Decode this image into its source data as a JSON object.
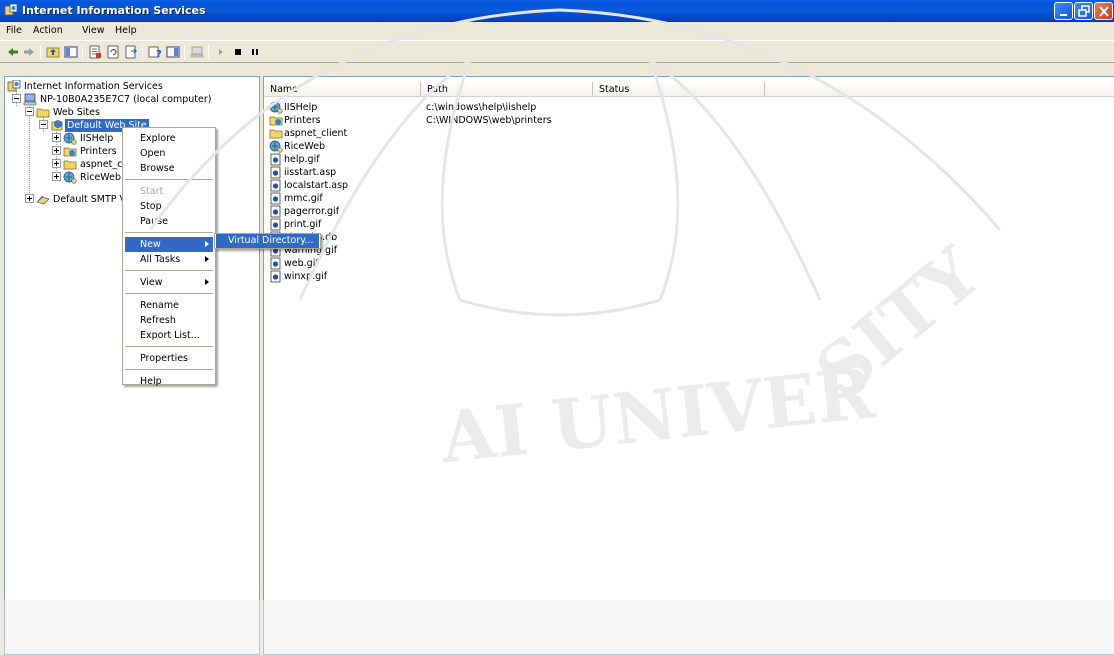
{
  "window": {
    "title": "Internet Information Services",
    "controls": {
      "minimize": "minimize-icon",
      "maximize": "maximize-icon",
      "close": "close-icon"
    }
  },
  "menubar": {
    "items": [
      "File",
      "Action",
      "View",
      "Help"
    ]
  },
  "toolbar": {
    "icons": [
      "back-arrow-icon",
      "forward-arrow-icon",
      "up-folder-icon",
      "show-hide-tree-icon",
      "properties-icon",
      "refresh-icon",
      "export-list-icon",
      "help-icon",
      "console-tree-icon",
      "computer-icon",
      "start-icon",
      "stop-icon",
      "pause-icon"
    ]
  },
  "tree": {
    "root": "Internet Information Services",
    "computer": "NP-10B0A235E7C7 (local computer)",
    "web_sites": "Web Sites",
    "default_site": "Default Web Site",
    "children": [
      "IISHelp",
      "Printers",
      "aspnet_client",
      "RiceWeb"
    ],
    "smtp": "Default SMTP Virtual Server"
  },
  "list": {
    "columns": [
      "Name",
      "Path",
      "Status"
    ],
    "rows": [
      {
        "name": "IISHelp",
        "path": "c:\\windows\\help\\iishelp",
        "icon": "virtual-directory-icon"
      },
      {
        "name": "Printers",
        "path": "C:\\WINDOWS\\web\\printers",
        "icon": "printers-folder-icon"
      },
      {
        "name": "aspnet_client",
        "path": "",
        "icon": "folder-icon"
      },
      {
        "name": "RiceWeb",
        "path": "",
        "icon": "virtual-directory-icon"
      },
      {
        "name": "help.gif",
        "path": "",
        "icon": "file-icon"
      },
      {
        "name": "iisstart.asp",
        "path": "",
        "icon": "file-icon"
      },
      {
        "name": "localstart.asp",
        "path": "",
        "icon": "file-icon"
      },
      {
        "name": "mmc.gif",
        "path": "",
        "icon": "file-icon"
      },
      {
        "name": "pagerror.gif",
        "path": "",
        "icon": "file-icon"
      },
      {
        "name": "print.gif",
        "path": "",
        "icon": "file-icon"
      },
      {
        "name": "Thumbs.db",
        "path": "",
        "icon": "file-icon"
      },
      {
        "name": "warning.gif",
        "path": "",
        "icon": "file-icon"
      },
      {
        "name": "web.gif",
        "path": "",
        "icon": "file-icon"
      },
      {
        "name": "winxp.gif",
        "path": "",
        "icon": "file-icon"
      }
    ]
  },
  "context_menu": {
    "groups": [
      [
        "Explore",
        "Open",
        "Browse"
      ],
      [
        "Start",
        "Stop",
        "Pause"
      ],
      [
        "New",
        "All Tasks"
      ],
      [
        "View"
      ],
      [
        "Rename",
        "Refresh",
        "Export List..."
      ],
      [
        "Properties"
      ],
      [
        "Help"
      ]
    ],
    "disabled": [
      "Start"
    ],
    "submenu_items": [
      "New",
      "All Tasks",
      "View"
    ],
    "highlighted": "New",
    "submenu": {
      "items": [
        "Virtual Directory..."
      ]
    }
  },
  "watermark": {
    "top_text": "UNIVERSITY",
    "bottom_text": "UNIVERSITY"
  }
}
